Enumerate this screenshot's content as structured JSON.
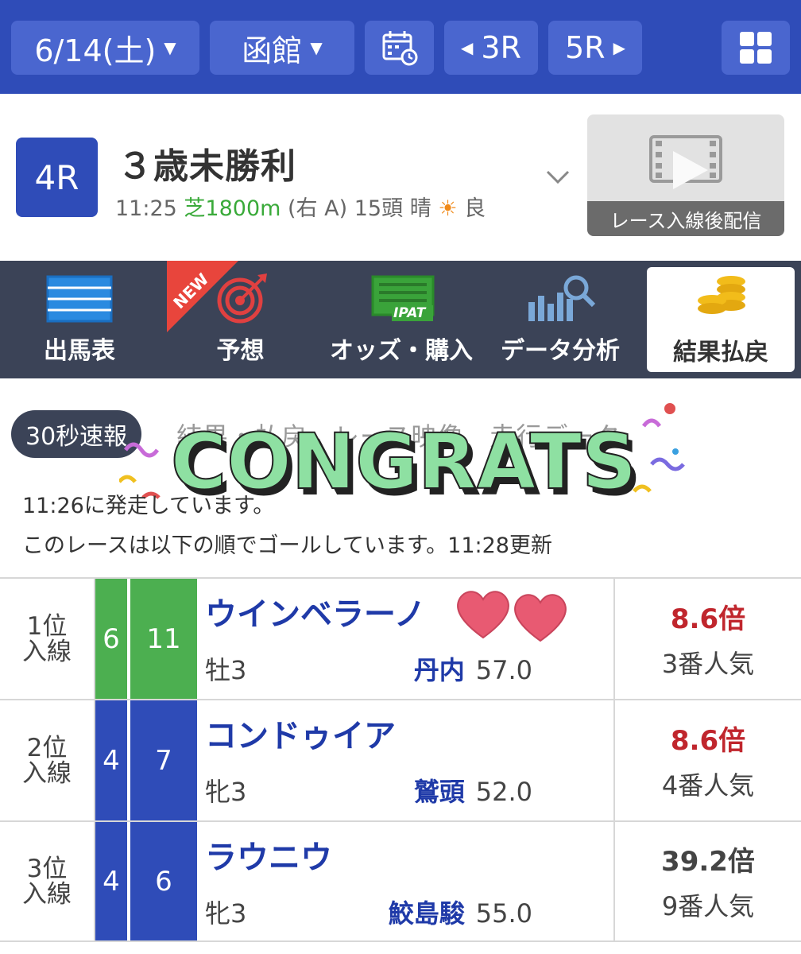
{
  "topbar": {
    "date": "6/14(土)",
    "venue": "函館",
    "prev_race": "3R",
    "next_race": "5R"
  },
  "race": {
    "number": "4R",
    "title": "３歳未勝利",
    "time": "11:25",
    "course": "芝1800m",
    "direction": "(右 A)",
    "runners": "15頭",
    "weather": "晴",
    "going": "良",
    "video_caption": "レース入線後配信"
  },
  "nav": {
    "items": [
      {
        "label": "出馬表"
      },
      {
        "label": "予想"
      },
      {
        "label": "オッズ・購入"
      },
      {
        "label": "データ分析"
      },
      {
        "label": "結果払戻"
      }
    ],
    "new_badge": "NEW",
    "ipat_text": "IPAT"
  },
  "summary": {
    "pill": "30秒速報",
    "tabs_behind": "結果・払戻　レース映像　走行データ",
    "overlay": "CONGRATS",
    "line1": "11:26に発走しています。",
    "line2": "このレースは以下の順でゴールしています。11:28更新"
  },
  "results": [
    {
      "place_top": "1位",
      "place_bottom": "入線",
      "waku": "6",
      "uma": "11",
      "horse": "ウインベラーノ",
      "sex_age": "牡3",
      "jockey": "丹内",
      "weight": "57.0",
      "odds": "8.6倍",
      "popularity": "3番人気"
    },
    {
      "place_top": "2位",
      "place_bottom": "入線",
      "waku": "4",
      "uma": "7",
      "horse": "コンドゥイア",
      "sex_age": "牝3",
      "jockey": "鷲頭",
      "weight": "52.0",
      "odds": "8.6倍",
      "popularity": "4番人気"
    },
    {
      "place_top": "3位",
      "place_bottom": "入線",
      "waku": "4",
      "uma": "6",
      "horse": "ラウニウ",
      "sex_age": "牝3",
      "jockey": "鮫島駿",
      "weight": "55.0",
      "odds": "39.2倍",
      "popularity": "9番人気"
    }
  ],
  "colors": {
    "brand_blue": "#2f4cb8",
    "waku_green": "#4caf50",
    "waku_blue": "#2f4cb8",
    "odds_red": "#c0262d",
    "odds_dark": "#444444"
  }
}
